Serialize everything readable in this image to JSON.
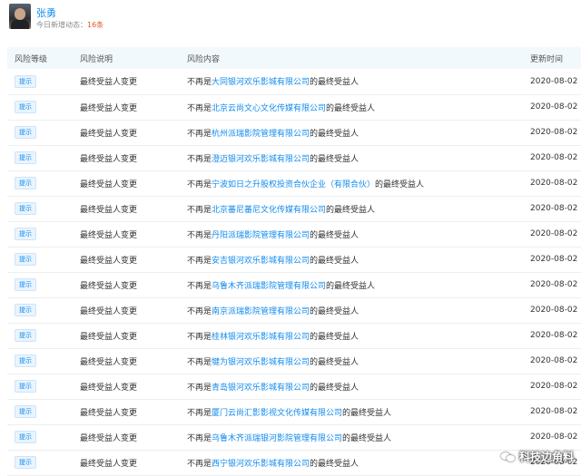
{
  "person": {
    "name": "张勇",
    "today_label": "今日新增动态：",
    "today_count": "16条"
  },
  "table": {
    "headers": [
      "风险等级",
      "风险说明",
      "风险内容",
      "更新时间"
    ],
    "rows": [
      {
        "level": "提示",
        "desc": "最终受益人变更",
        "prefix": "不再是",
        "company": "大同银河欢乐影城有限公司",
        "suffix": "的最终受益人",
        "date": "2020-08-02"
      },
      {
        "level": "提示",
        "desc": "最终受益人变更",
        "prefix": "不再是",
        "company": "北京云尚文心文化传媒有限公司",
        "suffix": "的最终受益人",
        "date": "2020-08-02"
      },
      {
        "level": "提示",
        "desc": "最终受益人变更",
        "prefix": "不再是",
        "company": "杭州派瑞影院管理有限公司",
        "suffix": "的最终受益人",
        "date": "2020-08-02"
      },
      {
        "level": "提示",
        "desc": "最终受益人变更",
        "prefix": "不再是",
        "company": "澄迈银河欢乐影城有限公司",
        "suffix": "的最终受益人",
        "date": "2020-08-02"
      },
      {
        "level": "提示",
        "desc": "最终受益人变更",
        "prefix": "不再是",
        "company": "宁波如日之升股权投资合伙企业（有限合伙）",
        "suffix": "的最终受益人",
        "date": "2020-08-02"
      },
      {
        "level": "提示",
        "desc": "最终受益人变更",
        "prefix": "不再是",
        "company": "北京蕃尼蕃尼文化传媒有限公司",
        "suffix": "的最终受益人",
        "date": "2020-08-02"
      },
      {
        "level": "提示",
        "desc": "最终受益人变更",
        "prefix": "不再是",
        "company": "丹阳派瑞影院管理有限公司",
        "suffix": "的最终受益人",
        "date": "2020-08-02"
      },
      {
        "level": "提示",
        "desc": "最终受益人变更",
        "prefix": "不再是",
        "company": "安吉银河欢乐影城有限公司",
        "suffix": "的最终受益人",
        "date": "2020-08-02"
      },
      {
        "level": "提示",
        "desc": "最终受益人变更",
        "prefix": "不再是",
        "company": "乌鲁木齐派瑞影院管理有限公司",
        "suffix": "的最终受益人",
        "date": "2020-08-02"
      },
      {
        "level": "提示",
        "desc": "最终受益人变更",
        "prefix": "不再是",
        "company": "南京派瑞影院管理有限公司",
        "suffix": "的最终受益人",
        "date": "2020-08-02"
      },
      {
        "level": "提示",
        "desc": "最终受益人变更",
        "prefix": "不再是",
        "company": "桂林银河欢乐影城有限公司",
        "suffix": "的最终受益人",
        "date": "2020-08-02"
      },
      {
        "level": "提示",
        "desc": "最终受益人变更",
        "prefix": "不再是",
        "company": "犍为银河欢乐影城有限公司",
        "suffix": "的最终受益人",
        "date": "2020-08-02"
      },
      {
        "level": "提示",
        "desc": "最终受益人变更",
        "prefix": "不再是",
        "company": "青岛银河欢乐影城有限公司",
        "suffix": "的最终受益人",
        "date": "2020-08-02"
      },
      {
        "level": "提示",
        "desc": "最终受益人变更",
        "prefix": "不再是",
        "company": "厦门云尚汇影影视文化传媒有限公司",
        "suffix": "的最终受益人",
        "date": "2020-08-02"
      },
      {
        "level": "提示",
        "desc": "最终受益人变更",
        "prefix": "不再是",
        "company": "乌鲁木齐派瑞银河影院管理有限公司",
        "suffix": "的最终受益人",
        "date": "2020-08-02"
      },
      {
        "level": "提示",
        "desc": "最终受益人变更",
        "prefix": "不再是",
        "company": "西宁银河欢乐影城有限公司",
        "suffix": "的最终受益人",
        "date": "2020-08-02"
      }
    ]
  },
  "watermark": {
    "text": "科技边角料",
    "icon": "wechat-icon"
  },
  "colors": {
    "link": "#128bed",
    "count": "#e0582a",
    "header_bg": "#f2f9fc"
  }
}
